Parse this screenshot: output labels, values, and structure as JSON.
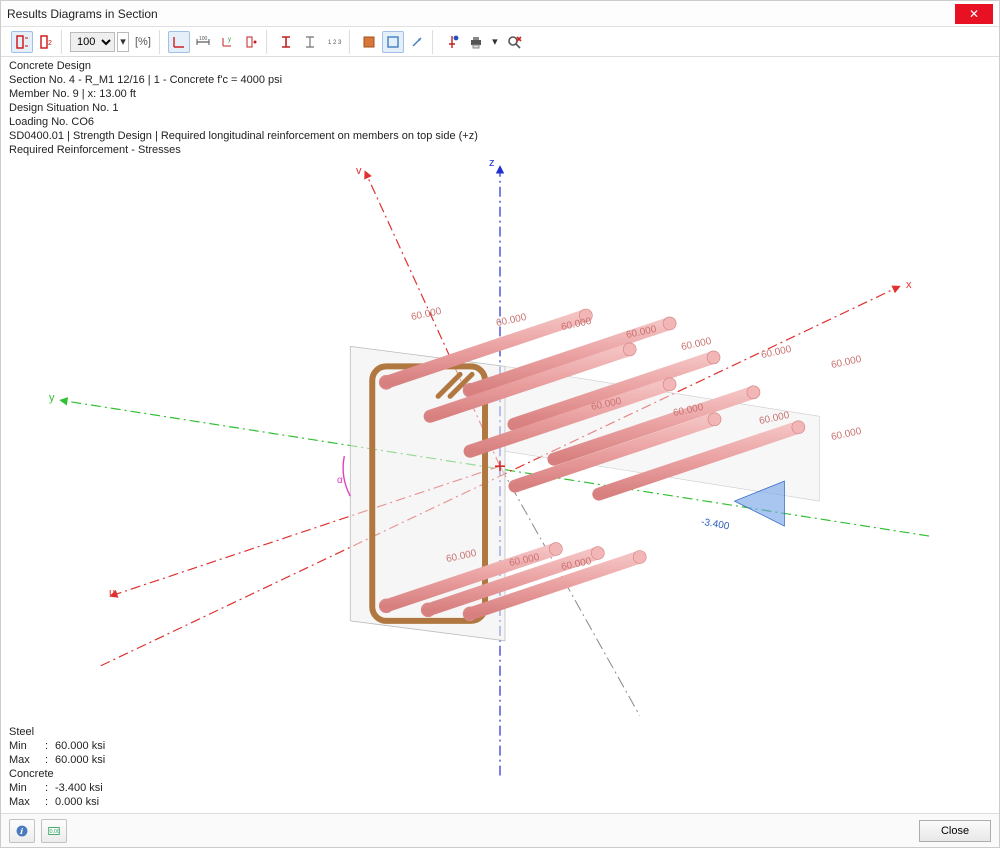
{
  "window": {
    "title": "Results Diagrams in Section"
  },
  "toolbar": {
    "zoom_value": "100",
    "zoom_unit": "[%]"
  },
  "info": {
    "line1": "Concrete Design",
    "line2": "Section No. 4 - R_M1 12/16 | 1 - Concrete f'c = 4000 psi",
    "line3": "Member No. 9 | x: 13.00 ft",
    "line4": "Design Situation No. 1",
    "line5": "Loading No. CO6",
    "line6": "SD0400.01 | Strength Design | Required longitudinal reinforcement on members on top side (+z)",
    "line7": "Required Reinforcement - Stresses"
  },
  "legend": {
    "steel_header": "Steel",
    "steel_min_label": "Min",
    "steel_min_value": "60.000 ksi",
    "steel_max_label": "Max",
    "steel_max_value": "60.000 ksi",
    "concrete_header": "Concrete",
    "conc_min_label": "Min",
    "conc_min_value": "-3.400 ksi",
    "conc_max_label": "Max",
    "conc_max_value": "0.000 ksi"
  },
  "axes": {
    "x": "x",
    "y": "y",
    "z": "z",
    "u": "u",
    "v": "v",
    "alpha": "α"
  },
  "values": {
    "rebar_stress": "60.000",
    "concrete_stress": "-3.400"
  },
  "footer": {
    "close": "Close"
  },
  "colors": {
    "axis_x": "#e03030",
    "axis_y": "#30c030",
    "axis_z": "#2030d0",
    "axis_uv": "#e03030",
    "rebar": "#e9a0a0",
    "stirrup": "#b07840",
    "concrete_surf": "#e6e6e6",
    "alpha": "#e040c0"
  }
}
